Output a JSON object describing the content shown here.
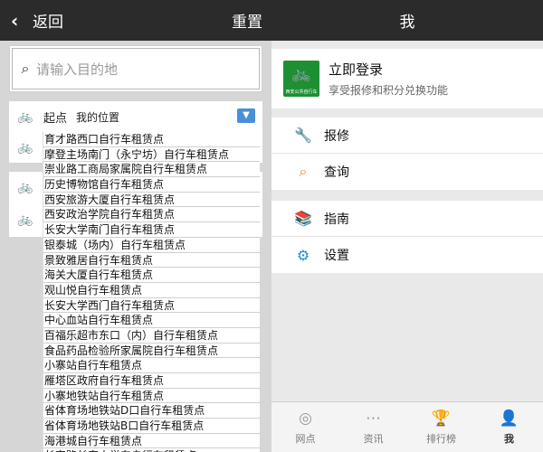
{
  "left": {
    "topbar": {
      "back_icon": "chevron-left-icon",
      "back_label": "返回",
      "reset_label": "重置"
    },
    "search": {
      "placeholder": "请输入目的地",
      "icon": "search-icon"
    },
    "start": {
      "label": "起点",
      "value": "我的位置",
      "dropdown_icon": "chevron-down-icon"
    },
    "dropdown_options": [
      "育才路西口自行车租赁点",
      "摩登主场南门（永宁坊）自行车租赁点",
      "崇业路工商局家属院自行车租赁点",
      "历史博物馆自行车租赁点",
      "西安旅游大厦自行车租赁点",
      "西安政治学院自行车租赁点",
      "长安大学南门自行车租赁点",
      "银泰城（场内）自行车租赁点",
      "景致雅居自行车租赁点",
      "海关大厦自行车租赁点",
      "观山悦自行车租赁点",
      "长安大学西门自行车租赁点",
      "中心血站自行车租赁点",
      "百福乐超市东口（内）自行车租赁点",
      "食品药品检验所家属院自行车租赁点",
      "小寨站自行车租赁点",
      "雁塔区政府自行车租赁点",
      "小寨地铁站自行车租赁点",
      "省体育场地铁站D口自行车租赁点",
      "省体育场地铁站B口自行车租赁点",
      "海港城自行车租赁点",
      "长安路长安大学东自行车租赁点"
    ]
  },
  "right": {
    "title": "我",
    "login": {
      "title": "立即登录",
      "subtitle": "享受报修和积分兑换功能",
      "logo_text": "西安公共自行车"
    },
    "group1": [
      {
        "label": "报修",
        "icon": "wrench-icon",
        "color": "#3a7fd0"
      },
      {
        "label": "查询",
        "icon": "search-icon",
        "color": "#e8862a"
      }
    ],
    "group2": [
      {
        "label": "指南",
        "icon": "book-icon",
        "color": "#6a9a2a"
      },
      {
        "label": "设置",
        "icon": "gear-icon",
        "color": "#1e90d8"
      }
    ],
    "tabs": [
      {
        "label": "网点",
        "icon": "location-pin-icon",
        "active": false
      },
      {
        "label": "资讯",
        "icon": "chat-bubble-icon",
        "active": false
      },
      {
        "label": "排行榜",
        "icon": "trophy-icon",
        "active": false
      },
      {
        "label": "我",
        "icon": "person-icon",
        "active": true
      }
    ]
  },
  "colors": {
    "topbar": "#2b2b2b",
    "active_tab": "#17a81b",
    "logo_green": "#1f8f34"
  }
}
